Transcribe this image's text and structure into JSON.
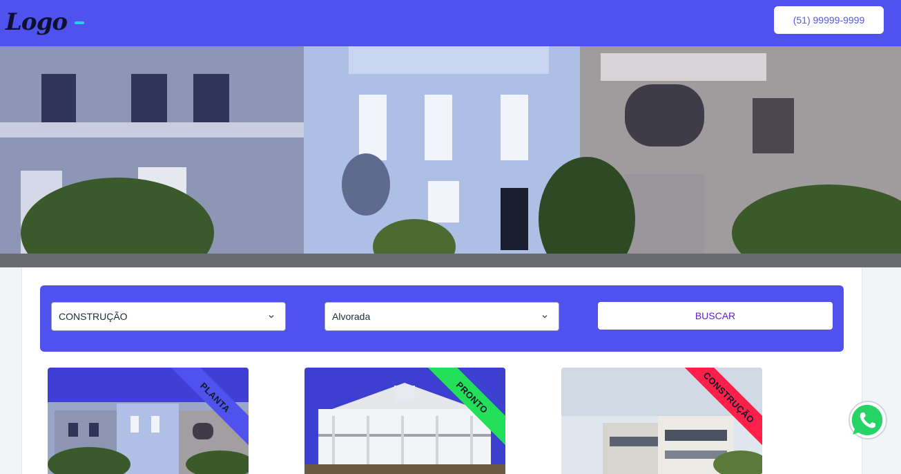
{
  "header": {
    "logo_text": "Logo",
    "phone": "(51) 99999-9999"
  },
  "filters": {
    "status_select": "CONSTRUÇÃO",
    "city_select": "Alvorada",
    "search_button": "BUSCAR"
  },
  "cards": [
    {
      "badge": "PLANTA",
      "badge_color": "#4f52ec"
    },
    {
      "badge": "PRONTO",
      "badge_color": "#22e05a"
    },
    {
      "badge": "CONSTRUÇÃO",
      "badge_color": "#ff1f4b"
    }
  ],
  "colors": {
    "brand": "#4f52ec",
    "whatsapp": "#25d366"
  }
}
